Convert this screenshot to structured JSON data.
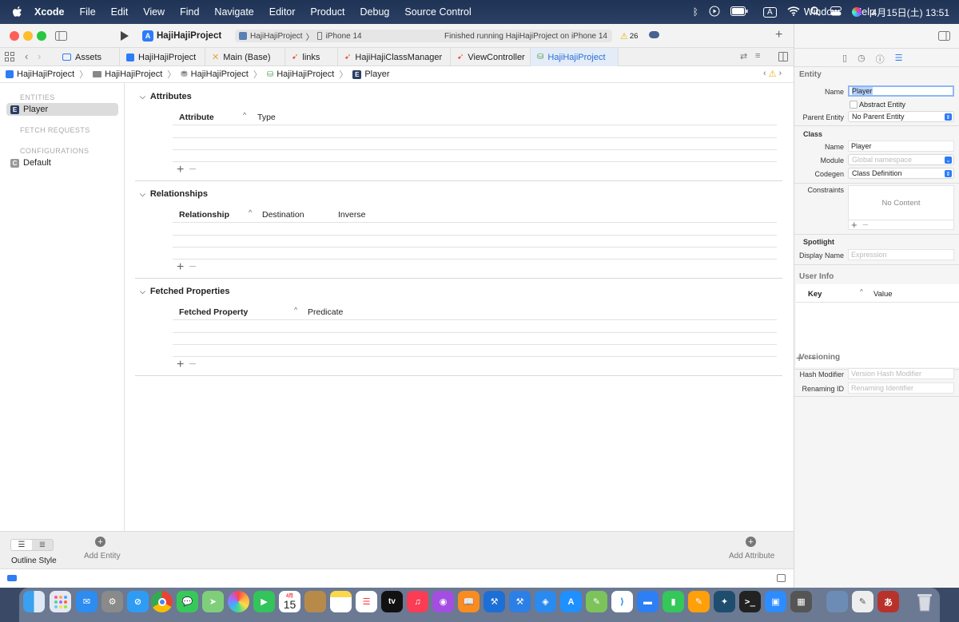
{
  "menubar": {
    "app_name": "Xcode",
    "items": [
      "File",
      "Edit",
      "View",
      "Find",
      "Navigate",
      "Editor",
      "Product",
      "Debug",
      "Source Control",
      "Window",
      "Help"
    ],
    "input_mode": "A",
    "datetime": "4月15日(土) 13:51"
  },
  "toolbar": {
    "project_title": "HajiHajiProject",
    "scheme": "HajiHajiProject",
    "device": "iPhone 14",
    "status": "Finished running HajiHajiProject on iPhone 14",
    "warning_count": "26"
  },
  "tabs": [
    {
      "label": "Assets",
      "icon": "assets-icon"
    },
    {
      "label": "HajiHajiProject",
      "icon": "app-icon"
    },
    {
      "label": "Main (Base)",
      "icon": "storyboard-icon"
    },
    {
      "label": "links",
      "icon": "swift-icon"
    },
    {
      "label": "HajiHajiClassManager",
      "icon": "swift-icon"
    },
    {
      "label": "ViewController",
      "icon": "swift-icon"
    },
    {
      "label": "HajiHajiProject",
      "icon": "datamodel-icon",
      "active": true
    }
  ],
  "breadcrumb": [
    "HajiHajiProject",
    "HajiHajiProject",
    "HajiHajiProject",
    "HajiHajiProject",
    "Player"
  ],
  "sidebar": {
    "entities_header": "ENTITIES",
    "entities": [
      {
        "badge": "E",
        "label": "Player"
      }
    ],
    "fetch_requests_header": "FETCH REQUESTS",
    "configurations_header": "CONFIGURATIONS",
    "configurations": [
      {
        "badge": "C",
        "label": "Default"
      }
    ]
  },
  "editor": {
    "attributes": {
      "title": "Attributes",
      "columns": [
        "Attribute",
        "Type"
      ]
    },
    "relationships": {
      "title": "Relationships",
      "columns": [
        "Relationship",
        "Destination",
        "Inverse"
      ]
    },
    "fetched": {
      "title": "Fetched Properties",
      "columns": [
        "Fetched Property",
        "Predicate"
      ]
    }
  },
  "bottombar": {
    "outline_style": "Outline Style",
    "add_entity": "Add Entity",
    "add_attribute": "Add Attribute"
  },
  "inspector": {
    "entity_header": "Entity",
    "name_label": "Name",
    "name_value": "Player",
    "abstract_label": "Abstract Entity",
    "parent_label": "Parent Entity",
    "parent_value": "No Parent Entity",
    "class_header": "Class",
    "class_name_label": "Name",
    "class_name_value": "Player",
    "module_label": "Module",
    "module_placeholder": "Global namespace",
    "codegen_label": "Codegen",
    "codegen_value": "Class Definition",
    "constraints_label": "Constraints",
    "constraints_empty": "No Content",
    "spotlight_header": "Spotlight",
    "display_name_label": "Display Name",
    "display_name_placeholder": "Expression",
    "userinfo_header": "User Info",
    "key_col": "Key",
    "value_col": "Value",
    "versioning_header": "Versioning",
    "hash_label": "Hash Modifier",
    "hash_placeholder": "Version Hash Modifier",
    "renaming_label": "Renaming ID",
    "renaming_placeholder": "Renaming Identifier"
  },
  "dock": {
    "calendar_month": "4月",
    "calendar_day": "15",
    "tv_label": "tv"
  }
}
